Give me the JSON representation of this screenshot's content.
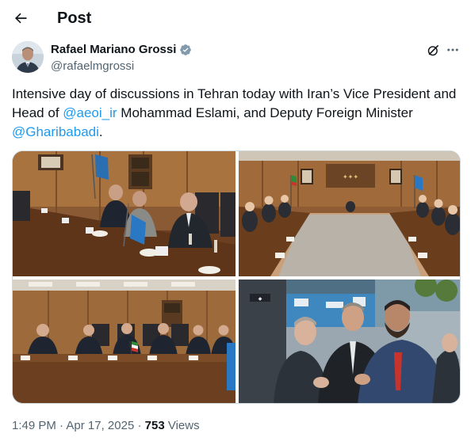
{
  "header": {
    "title": "Post"
  },
  "author": {
    "name": "Rafael Mariano Grossi",
    "handle": "@rafaelmgrossi"
  },
  "post": {
    "part1": "Intensive day of discussions in Tehran today with Iran’s Vice President and Head of ",
    "mention1": "@aeoi_ir",
    "part2": " Mohammad Eslami, and Deputy Foreign Minister ",
    "mention2": "@Gharibabadi",
    "part3": "."
  },
  "meta": {
    "time": "1:49 PM",
    "sep1": " · ",
    "date": "Apr 17, 2025",
    "sep2": " · ",
    "views_count": "753",
    "views_label": " Views"
  },
  "colors": {
    "accent": "#1d9bf0",
    "verified": "#829aab",
    "text": "#0f1419",
    "muted": "#536471"
  },
  "icons": [
    "back-arrow-icon",
    "verified-badge-icon",
    "grok-icon",
    "more-icon"
  ]
}
